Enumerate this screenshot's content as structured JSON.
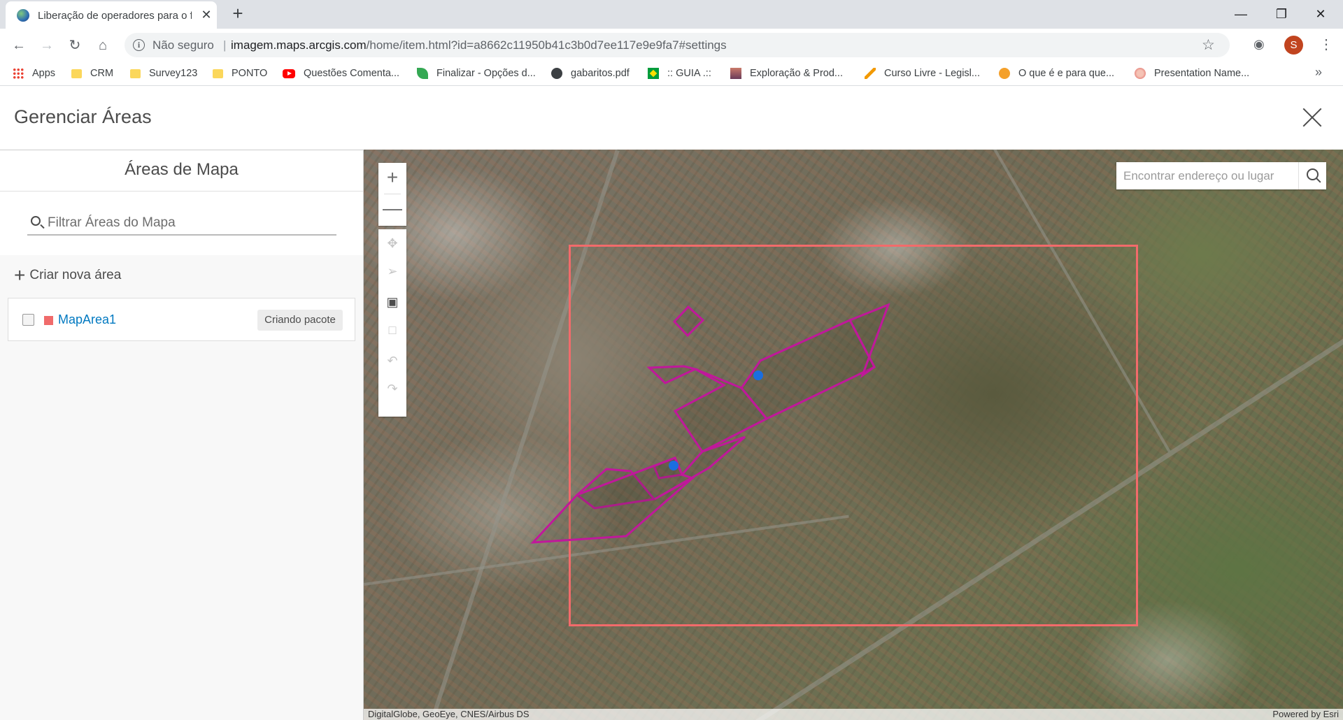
{
  "browser": {
    "tab_title": "Liberação de operadores para o f",
    "tab_close": "✕",
    "new_tab": "+",
    "insecure_label": "Não seguro",
    "separator": "|",
    "url_host": "imagem.maps.arcgis.com",
    "url_path": "/home/item.html?id=a8662c11950b41c3b0d7ee117e9e9fa7#settings",
    "avatar_initial": "S",
    "bookmarks": [
      {
        "label": "Apps",
        "icon": "apps-grid-icon"
      },
      {
        "label": "CRM",
        "icon": "folder-icon"
      },
      {
        "label": "Survey123",
        "icon": "folder-icon"
      },
      {
        "label": "PONTO",
        "icon": "folder-icon"
      },
      {
        "label": "Questões Comenta...",
        "icon": "youtube-icon"
      },
      {
        "label": "Finalizar - Opções d...",
        "icon": "leaf-icon"
      },
      {
        "label": "gabaritos.pdf",
        "icon": "globe-icon"
      },
      {
        "label": ":: GUIA .::",
        "icon": "brazil-flag-icon"
      },
      {
        "label": "Exploração & Prod...",
        "icon": "image-icon"
      },
      {
        "label": "Curso Livre - Legisl...",
        "icon": "pen-icon"
      },
      {
        "label": "O que é e para que...",
        "icon": "orange-icon"
      },
      {
        "label": "Presentation Name...",
        "icon": "flower-icon"
      }
    ],
    "bookmarks_more": "»"
  },
  "app": {
    "title": "Gerenciar Áreas",
    "sidebar": {
      "heading": "Áreas de Mapa",
      "filter_placeholder": "Filtrar Áreas do Mapa",
      "create_label": "Criar nova área",
      "areas": [
        {
          "name": "MapArea1",
          "status": "Criando pacote",
          "color": "#f06b6b",
          "checked": false
        }
      ]
    },
    "map": {
      "search_placeholder": "Encontrar endereço ou lugar",
      "attribution_left": "DigitalGlobe, GeoEye, CNES/Airbus DS",
      "attribution_right": "Powered by Esri",
      "extent_color": "#f26b6b",
      "polygon_color": "#c0189b",
      "vertex_color": "#1a6ee0",
      "tools": [
        "pan-icon",
        "select-icon",
        "draw-rectangle-icon",
        "edit-polygon-icon",
        "undo-icon",
        "redo-icon"
      ]
    }
  }
}
